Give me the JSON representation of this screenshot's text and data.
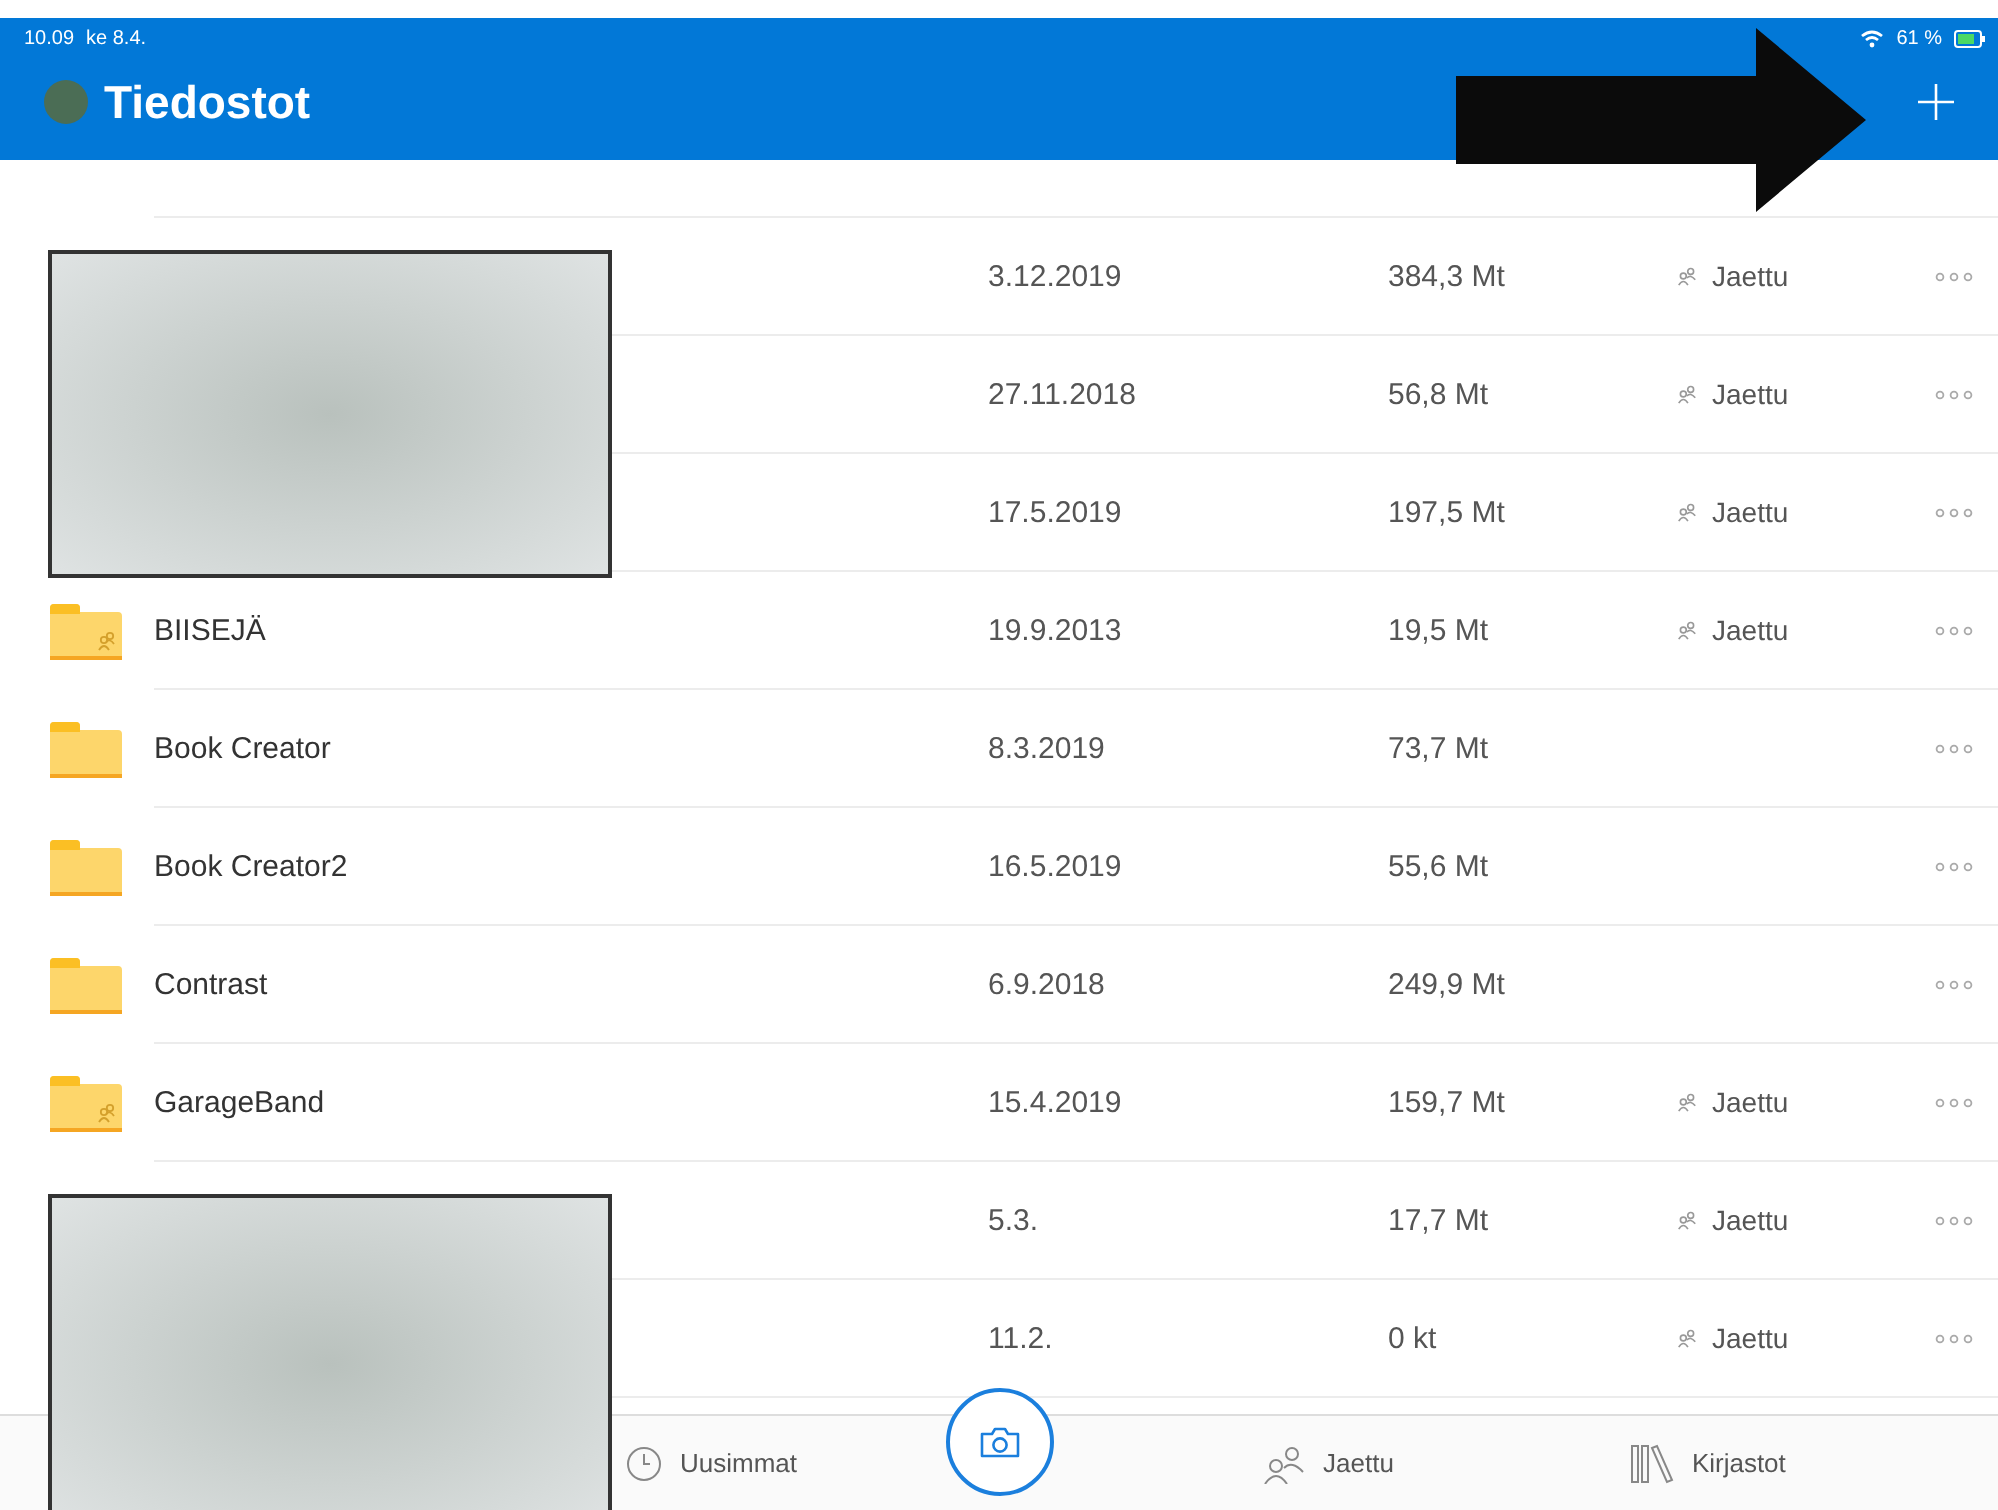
{
  "status_bar": {
    "time": "10.09",
    "date": "ke 8.4.",
    "battery": "61 %"
  },
  "header": {
    "title": "Tiedostot"
  },
  "rows": [
    {
      "date": "3.12.2019",
      "size": "384,3 Mt",
      "shared": "Jaettu"
    },
    {
      "date": "27.11.2018",
      "size": "56,8 Mt",
      "shared": "Jaettu"
    },
    {
      "date": "17.5.2019",
      "size": "197,5 Mt",
      "shared": "Jaettu"
    },
    {
      "kind": "shared-folder",
      "name": "BIISEJÄ",
      "date": "19.9.2013",
      "size": "19,5 Mt",
      "shared": "Jaettu"
    },
    {
      "kind": "folder",
      "name": "Book Creator",
      "date": "8.3.2019",
      "size": "73,7 Mt"
    },
    {
      "kind": "folder",
      "name": "Book Creator2",
      "date": "16.5.2019",
      "size": "55,6 Mt"
    },
    {
      "kind": "folder",
      "name": "Contrast",
      "date": "6.9.2018",
      "size": "249,9 Mt"
    },
    {
      "kind": "shared-folder",
      "name": "GarageBand",
      "date": "15.4.2019",
      "size": "159,7 Mt",
      "shared": "Jaettu"
    },
    {
      "date": "5.3.",
      "size": "17,7 Mt",
      "shared": "Jaettu"
    },
    {
      "date": "11.2.",
      "size": "0 kt",
      "shared": "Jaettu"
    }
  ],
  "tab_bar": [
    {
      "kind": "recent",
      "label": "Uusimmat"
    },
    {
      "kind": "camera"
    },
    {
      "kind": "shared",
      "label": "Jaettu"
    },
    {
      "kind": "libraries",
      "label": "Kirjastot"
    }
  ]
}
